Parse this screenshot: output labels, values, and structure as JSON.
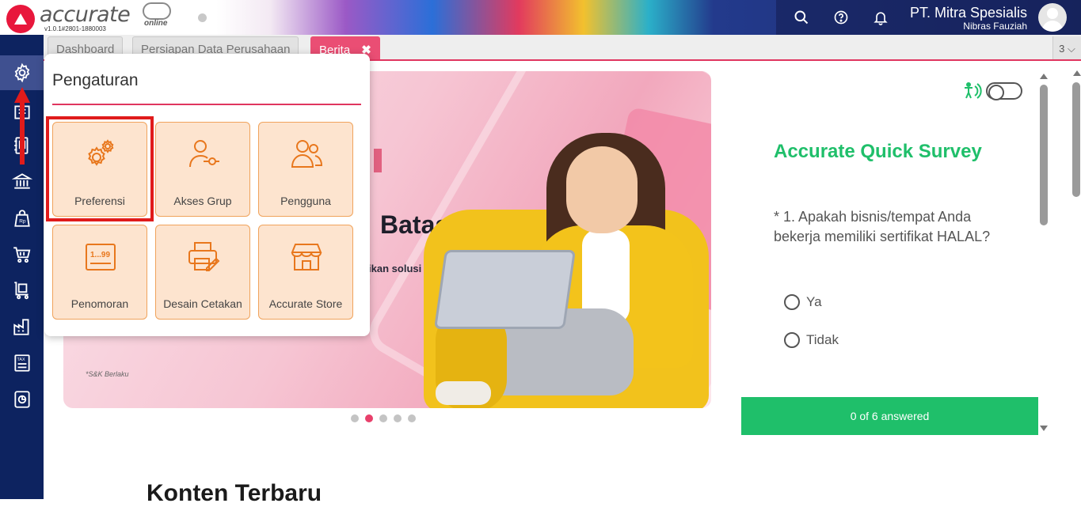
{
  "app": {
    "logo_text": "accurate",
    "logo_sub": "online",
    "version": "v1.0.1#2801-1880003",
    "company_name": "PT. Mitra Spesialis",
    "user_name": "Nibras Fauziah"
  },
  "topbar": {
    "icons": [
      "search-icon",
      "help-icon",
      "bell-icon",
      "avatar"
    ]
  },
  "sidebar": {
    "items": [
      {
        "icon": "gear-icon",
        "active": true
      },
      {
        "icon": "report-icon"
      },
      {
        "icon": "phone-book-icon"
      },
      {
        "icon": "bank-icon"
      },
      {
        "icon": "receivable-bag-icon"
      },
      {
        "icon": "cart-icon"
      },
      {
        "icon": "inventory-cart-icon"
      },
      {
        "icon": "factory-icon"
      },
      {
        "icon": "tax-icon"
      },
      {
        "icon": "chart-doc-icon"
      }
    ]
  },
  "tabs": [
    {
      "label": "Dashboard"
    },
    {
      "label": "Persiapan Data Perusahaan"
    },
    {
      "label": "Berita",
      "active": true,
      "close": "✖"
    }
  ],
  "tab_count": "3 ⌵",
  "popup": {
    "title": "Pengaturan",
    "tiles": [
      {
        "label": "Preferensi",
        "icon": "gears-icon"
      },
      {
        "label": "Akses Grup",
        "icon": "user-key-icon"
      },
      {
        "label": "Pengguna",
        "icon": "users-icon"
      },
      {
        "label": "Penomoran",
        "icon": "numbering-icon",
        "icon_text": "1...99"
      },
      {
        "label": "Desain Cetakan",
        "icon": "print-design-icon"
      },
      {
        "label": "Accurate Store",
        "icon": "store-icon"
      }
    ]
  },
  "banner": {
    "headline": "Batas!",
    "sub_line1": "rikan solusi",
    "sub_line2": "g",
    "terms": "*S&K Berlaku"
  },
  "carousel": {
    "count": 5,
    "active_index": 1
  },
  "section": {
    "title": "Konten Terbaru"
  },
  "survey": {
    "title": "Accurate Quick Survey",
    "question": "* 1. Apakah bisnis/tempat Anda bekerja memiliki sertifikat HALAL?",
    "options": [
      "Ya",
      "Tidak"
    ],
    "progress_text": "0 of 6 answered",
    "answered": 0,
    "total": 6
  },
  "colors": {
    "accent": "#e0355f",
    "survey_green": "#1fbf6a",
    "sidebar": "#0d2360",
    "tile_bg": "#fde4cf",
    "tile_icon": "#e8771d",
    "highlight": "#e01b1b"
  }
}
